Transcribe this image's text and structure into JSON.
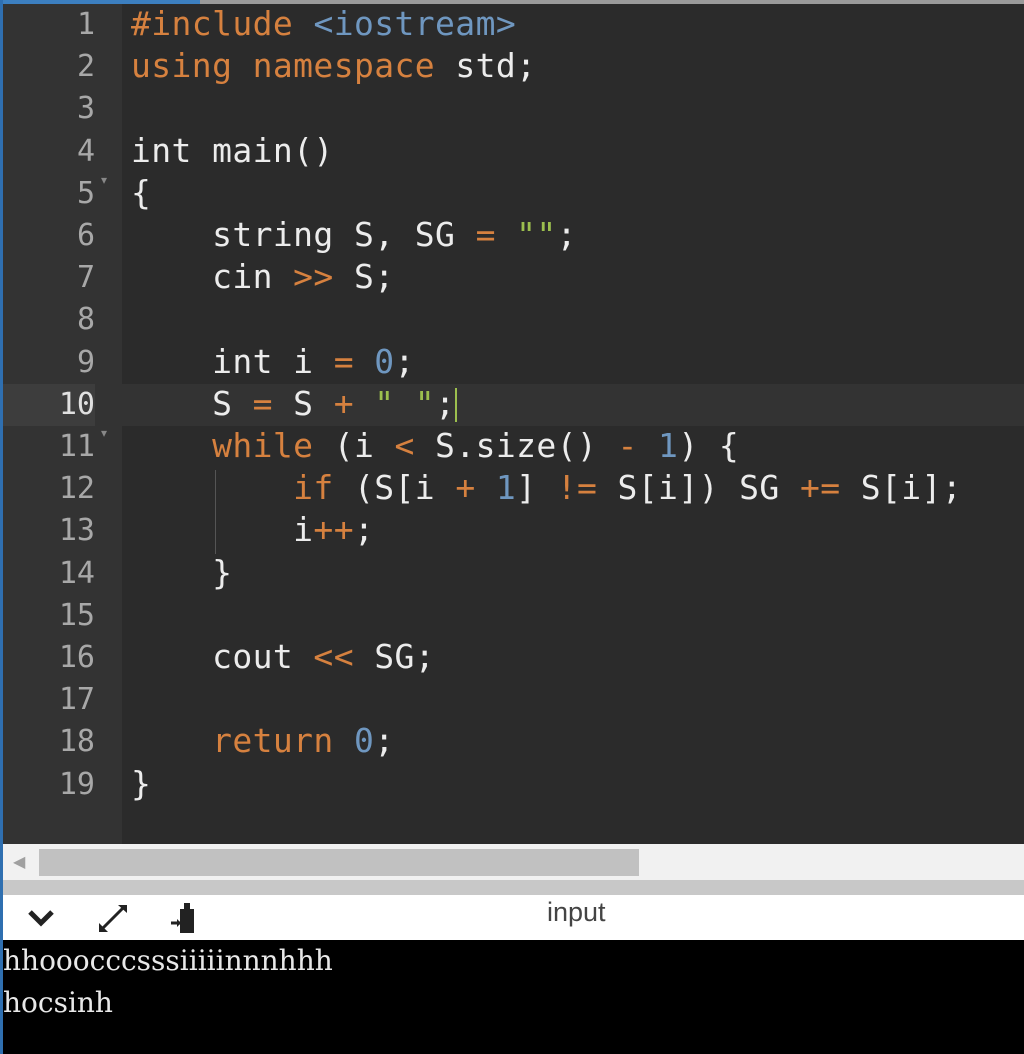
{
  "editor": {
    "active_line": 10,
    "lines": [
      {
        "n": "1",
        "tokens": [
          [
            "#include",
            "kw"
          ],
          [
            " ",
            "def"
          ],
          [
            "<iostream>",
            "inc"
          ]
        ]
      },
      {
        "n": "2",
        "tokens": [
          [
            "using",
            "kw"
          ],
          [
            " ",
            "def"
          ],
          [
            "namespace",
            "kw"
          ],
          [
            " std;",
            "def"
          ]
        ]
      },
      {
        "n": "3",
        "tokens": []
      },
      {
        "n": "4",
        "tokens": [
          [
            "int main()",
            "def"
          ]
        ]
      },
      {
        "n": "5",
        "fold": true,
        "tokens": [
          [
            "{",
            "def"
          ]
        ]
      },
      {
        "n": "6",
        "tokens": [
          [
            "    string S, SG ",
            "def"
          ],
          [
            "=",
            "op"
          ],
          [
            " ",
            "def"
          ],
          [
            "\"\"",
            "str"
          ],
          [
            ";",
            "def"
          ]
        ]
      },
      {
        "n": "7",
        "tokens": [
          [
            "    cin ",
            "def"
          ],
          [
            ">>",
            "op"
          ],
          [
            " S;",
            "def"
          ]
        ]
      },
      {
        "n": "8",
        "tokens": []
      },
      {
        "n": "9",
        "tokens": [
          [
            "    int i ",
            "def"
          ],
          [
            "=",
            "op"
          ],
          [
            " ",
            "def"
          ],
          [
            "0",
            "num"
          ],
          [
            ";",
            "def"
          ]
        ]
      },
      {
        "n": "10",
        "tokens": [
          [
            "    S ",
            "def"
          ],
          [
            "=",
            "op"
          ],
          [
            " S ",
            "def"
          ],
          [
            "+",
            "op"
          ],
          [
            " ",
            "def"
          ],
          [
            "\" \"",
            "str"
          ],
          [
            ";",
            "def"
          ]
        ],
        "cursor": true
      },
      {
        "n": "11",
        "fold": true,
        "tokens": [
          [
            "    ",
            "def"
          ],
          [
            "while",
            "kw"
          ],
          [
            " (i ",
            "def"
          ],
          [
            "<",
            "op"
          ],
          [
            " S.size() ",
            "def"
          ],
          [
            "-",
            "op"
          ],
          [
            " ",
            "def"
          ],
          [
            "1",
            "num"
          ],
          [
            ") {",
            "def"
          ]
        ]
      },
      {
        "n": "12",
        "tokens": [
          [
            "        ",
            "def"
          ],
          [
            "if",
            "kw"
          ],
          [
            " (S[i ",
            "def"
          ],
          [
            "+",
            "op"
          ],
          [
            " ",
            "def"
          ],
          [
            "1",
            "num"
          ],
          [
            "] ",
            "def"
          ],
          [
            "!=",
            "op"
          ],
          [
            " S[i]) SG ",
            "def"
          ],
          [
            "+=",
            "op"
          ],
          [
            " S[i];",
            "def"
          ]
        ]
      },
      {
        "n": "13",
        "tokens": [
          [
            "        i",
            "def"
          ],
          [
            "++",
            "op"
          ],
          [
            ";",
            "def"
          ]
        ]
      },
      {
        "n": "14",
        "tokens": [
          [
            "    }",
            "def"
          ]
        ]
      },
      {
        "n": "15",
        "tokens": []
      },
      {
        "n": "16",
        "tokens": [
          [
            "    cout ",
            "def"
          ],
          [
            "<<",
            "op"
          ],
          [
            " SG;",
            "def"
          ]
        ]
      },
      {
        "n": "17",
        "tokens": []
      },
      {
        "n": "18",
        "tokens": [
          [
            "    ",
            "def"
          ],
          [
            "return",
            "kw"
          ],
          [
            " ",
            "def"
          ],
          [
            "0",
            "num"
          ],
          [
            ";",
            "def"
          ]
        ]
      },
      {
        "n": "19",
        "tokens": [
          [
            "}",
            "def"
          ]
        ]
      }
    ]
  },
  "toolbar": {
    "icons": [
      "chevron-down-icon",
      "expand-icon",
      "clear-icon"
    ],
    "label": "input"
  },
  "output": {
    "lines": [
      "hhoooccсsssiiiiinnnhhh",
      "hocsinh"
    ]
  }
}
